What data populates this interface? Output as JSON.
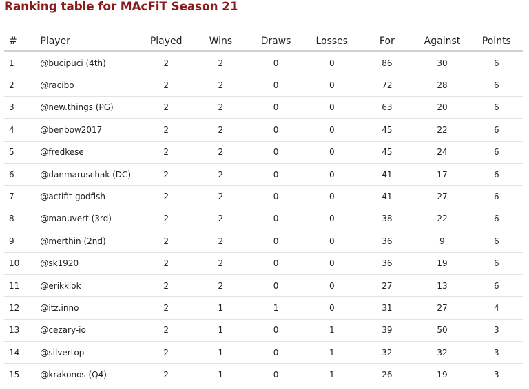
{
  "title": "Ranking table for MAcFiT Season 21",
  "colors": {
    "title": "#8b1a1a",
    "title_underline": "#d9787a"
  },
  "table": {
    "headers": [
      "#",
      "Player",
      "Played",
      "Wins",
      "Draws",
      "Losses",
      "For",
      "Against",
      "Points"
    ],
    "rows": [
      [
        "1",
        "@bucipuci (4th)",
        "2",
        "2",
        "0",
        "0",
        "86",
        "30",
        "6"
      ],
      [
        "2",
        "@racibo",
        "2",
        "2",
        "0",
        "0",
        "72",
        "28",
        "6"
      ],
      [
        "3",
        "@new.things (PG)",
        "2",
        "2",
        "0",
        "0",
        "63",
        "20",
        "6"
      ],
      [
        "4",
        "@benbow2017",
        "2",
        "2",
        "0",
        "0",
        "45",
        "22",
        "6"
      ],
      [
        "5",
        "@fredkese",
        "2",
        "2",
        "0",
        "0",
        "45",
        "24",
        "6"
      ],
      [
        "6",
        "@danmaruschak (DC)",
        "2",
        "2",
        "0",
        "0",
        "41",
        "17",
        "6"
      ],
      [
        "7",
        "@actifit-godfish",
        "2",
        "2",
        "0",
        "0",
        "41",
        "27",
        "6"
      ],
      [
        "8",
        "@manuvert (3rd)",
        "2",
        "2",
        "0",
        "0",
        "38",
        "22",
        "6"
      ],
      [
        "9",
        "@merthin (2nd)",
        "2",
        "2",
        "0",
        "0",
        "36",
        "9",
        "6"
      ],
      [
        "10",
        "@sk1920",
        "2",
        "2",
        "0",
        "0",
        "36",
        "19",
        "6"
      ],
      [
        "11",
        "@erikklok",
        "2",
        "2",
        "0",
        "0",
        "27",
        "13",
        "6"
      ],
      [
        "12",
        "@itz.inno",
        "2",
        "1",
        "1",
        "0",
        "31",
        "27",
        "4"
      ],
      [
        "13",
        "@cezary-io",
        "2",
        "1",
        "0",
        "1",
        "39",
        "50",
        "3"
      ],
      [
        "14",
        "@silvertop",
        "2",
        "1",
        "0",
        "1",
        "32",
        "32",
        "3"
      ],
      [
        "15",
        "@krakonos (Q4)",
        "2",
        "1",
        "0",
        "1",
        "26",
        "19",
        "3"
      ]
    ]
  }
}
